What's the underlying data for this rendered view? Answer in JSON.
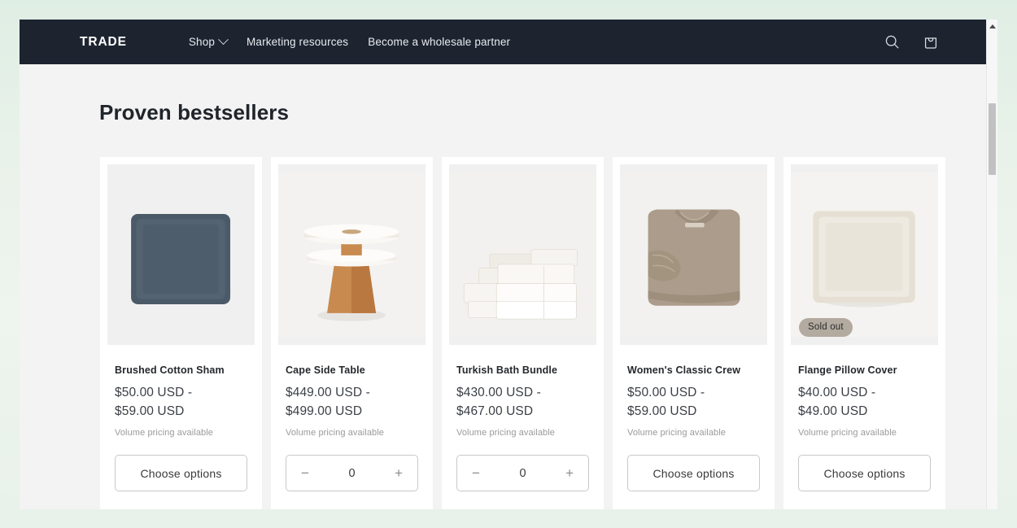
{
  "header": {
    "brand": "TRADE",
    "nav": [
      {
        "label": "Shop",
        "has_dropdown": true
      },
      {
        "label": "Marketing resources",
        "has_dropdown": false
      },
      {
        "label": "Become a wholesale partner",
        "has_dropdown": false
      }
    ],
    "actions": [
      {
        "icon": "search-icon"
      },
      {
        "icon": "shopping-bag-icon"
      }
    ],
    "background_color": "#1d2430",
    "text_color": "#e8eaee"
  },
  "main": {
    "section_title": "Proven bestsellers",
    "products": [
      {
        "title": "Brushed Cotton Sham",
        "price": "$50.00 USD - $59.00 USD",
        "price_line_1": "$50.00 USD -",
        "price_line_2": "$59.00 USD",
        "volume_note": "Volume pricing available",
        "action_type": "choose_options",
        "action_label": "Choose options",
        "badge": null,
        "image": "slate-blue-pillow-sham",
        "image_color": "#475563"
      },
      {
        "title": "Cape Side Table",
        "price": "$449.00 USD - $499.00 USD",
        "price_line_1": "$449.00 USD -",
        "price_line_2": "$499.00 USD",
        "volume_note": "Volume pricing available",
        "action_type": "quantity",
        "quantity_value": "0",
        "decrement_label": "−",
        "increment_label": "+",
        "badge": null,
        "image": "marble-wood-side-table",
        "image_color": "#c98a4f"
      },
      {
        "title": "Turkish Bath Bundle",
        "price": "$430.00 USD - $467.00 USD",
        "price_line_1": "$430.00 USD -",
        "price_line_2": "$467.00 USD",
        "volume_note": "Volume pricing available",
        "action_type": "quantity",
        "quantity_value": "0",
        "decrement_label": "−",
        "increment_label": "+",
        "badge": null,
        "image": "stacked-white-towels",
        "image_color": "#f4f2ee"
      },
      {
        "title": "Women's Classic Crew",
        "price": "$50.00 USD - $59.00 USD",
        "price_line_1": "$50.00 USD -",
        "price_line_2": "$59.00 USD",
        "volume_note": "Volume pricing available",
        "action_type": "choose_options",
        "action_label": "Choose options",
        "badge": null,
        "image": "folded-taupe-sweatshirt",
        "image_color": "#ab9c8b"
      },
      {
        "title": "Flange Pillow Cover",
        "price": "$40.00 USD - $49.00 USD",
        "price_line_1": "$40.00 USD -",
        "price_line_2": "$49.00 USD",
        "volume_note": "Volume pricing available",
        "action_type": "choose_options",
        "action_label": "Choose options",
        "badge": "Sold out",
        "image": "cream-flange-pillow-cover",
        "image_color": "#ece7dd"
      }
    ]
  },
  "colors": {
    "page_background": "#f3f3f3",
    "card_background": "#ffffff",
    "outer_background": "#e4efe8",
    "badge_background": "#b3aaa0",
    "border": "#c9c9c9",
    "muted_text": "#9a9a9a"
  }
}
